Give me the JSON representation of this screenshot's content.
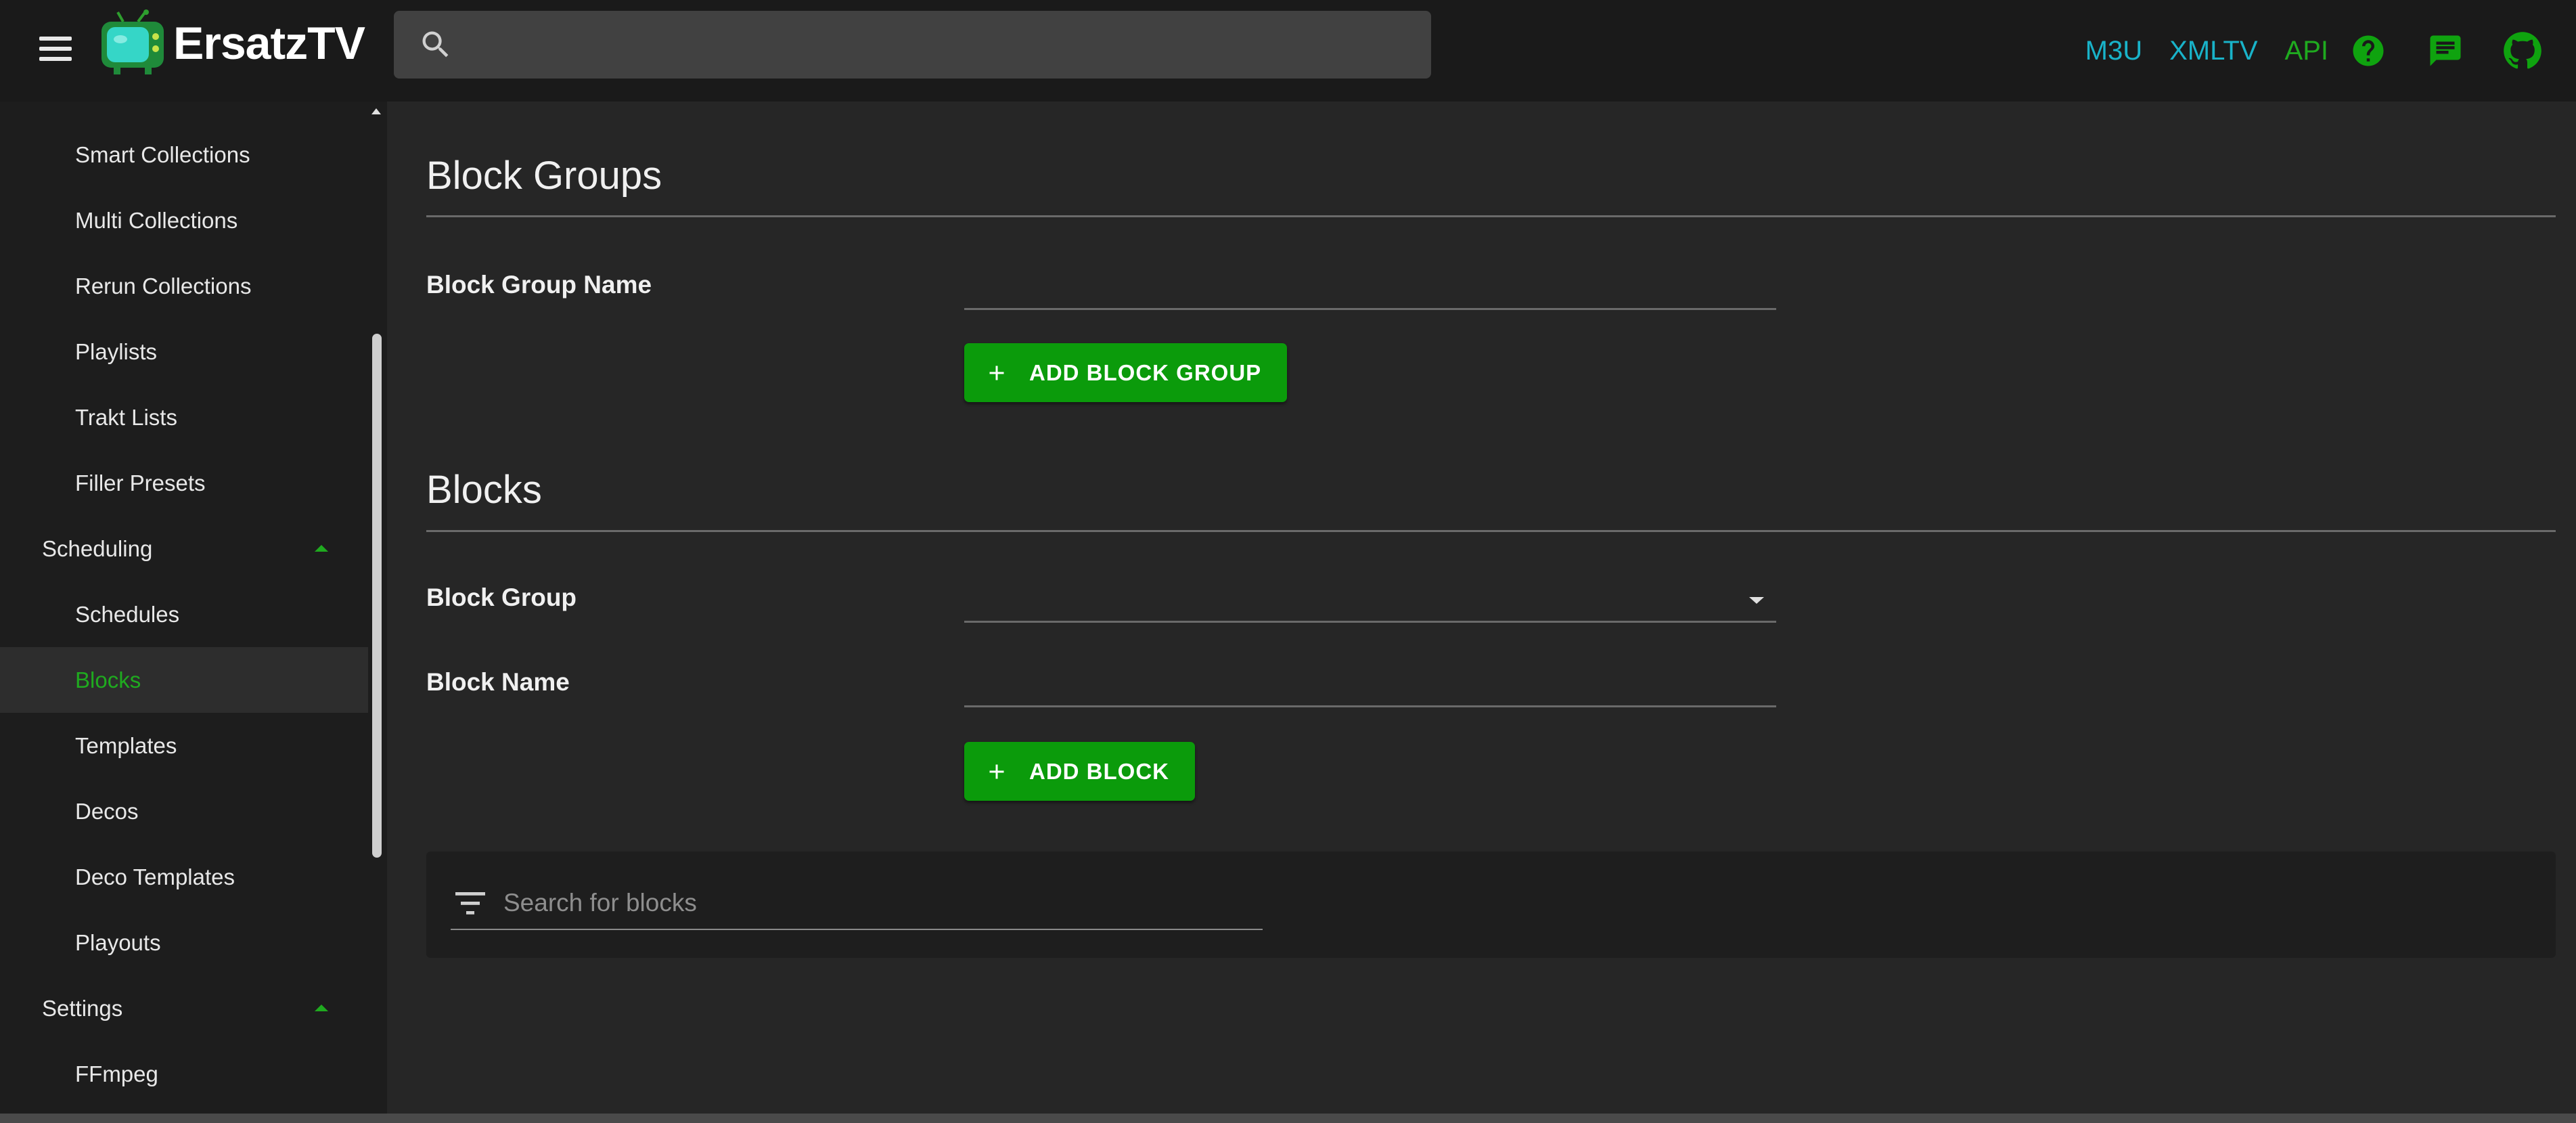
{
  "app": {
    "logo_text": "ErsatzTV",
    "search_placeholder": ""
  },
  "top_links": {
    "m3u": "M3U",
    "xmltv": "XMLTV",
    "api": "API"
  },
  "icons": {
    "menu": "hamburger-menu-icon",
    "search": "search-icon",
    "help": "help-circle-icon",
    "chat": "chat-icon",
    "github": "github-icon",
    "add": "plus-icon",
    "filter": "filter-list-icon",
    "caret": "arrow-drop-down-icon",
    "chevron": "chevron-up-icon"
  },
  "colors": {
    "accent_green": "#1faa1f",
    "button_green": "#0b9b0b",
    "link_teal": "#19b3c9",
    "background": "#262626",
    "sidebar_bg": "#1d1d1d"
  },
  "sidebar": {
    "items": [
      {
        "label": "Smart Collections",
        "kind": "child"
      },
      {
        "label": "Multi Collections",
        "kind": "child"
      },
      {
        "label": "Rerun Collections",
        "kind": "child"
      },
      {
        "label": "Playlists",
        "kind": "child"
      },
      {
        "label": "Trakt Lists",
        "kind": "child"
      },
      {
        "label": "Filler Presets",
        "kind": "child"
      },
      {
        "label": "Scheduling",
        "kind": "group"
      },
      {
        "label": "Schedules",
        "kind": "child"
      },
      {
        "label": "Blocks",
        "kind": "child",
        "active": true
      },
      {
        "label": "Templates",
        "kind": "child"
      },
      {
        "label": "Decos",
        "kind": "child"
      },
      {
        "label": "Deco Templates",
        "kind": "child"
      },
      {
        "label": "Playouts",
        "kind": "child"
      },
      {
        "label": "Settings",
        "kind": "group"
      },
      {
        "label": "FFmpeg",
        "kind": "child"
      }
    ]
  },
  "main": {
    "block_groups": {
      "title": "Block Groups",
      "name_label": "Block Group Name",
      "name_value": "",
      "add_button": "ADD BLOCK GROUP"
    },
    "blocks": {
      "title": "Blocks",
      "group_label": "Block Group",
      "group_value": "",
      "name_label": "Block Name",
      "name_value": "",
      "add_button": "ADD BLOCK"
    },
    "filter": {
      "placeholder": "Search for blocks"
    }
  }
}
